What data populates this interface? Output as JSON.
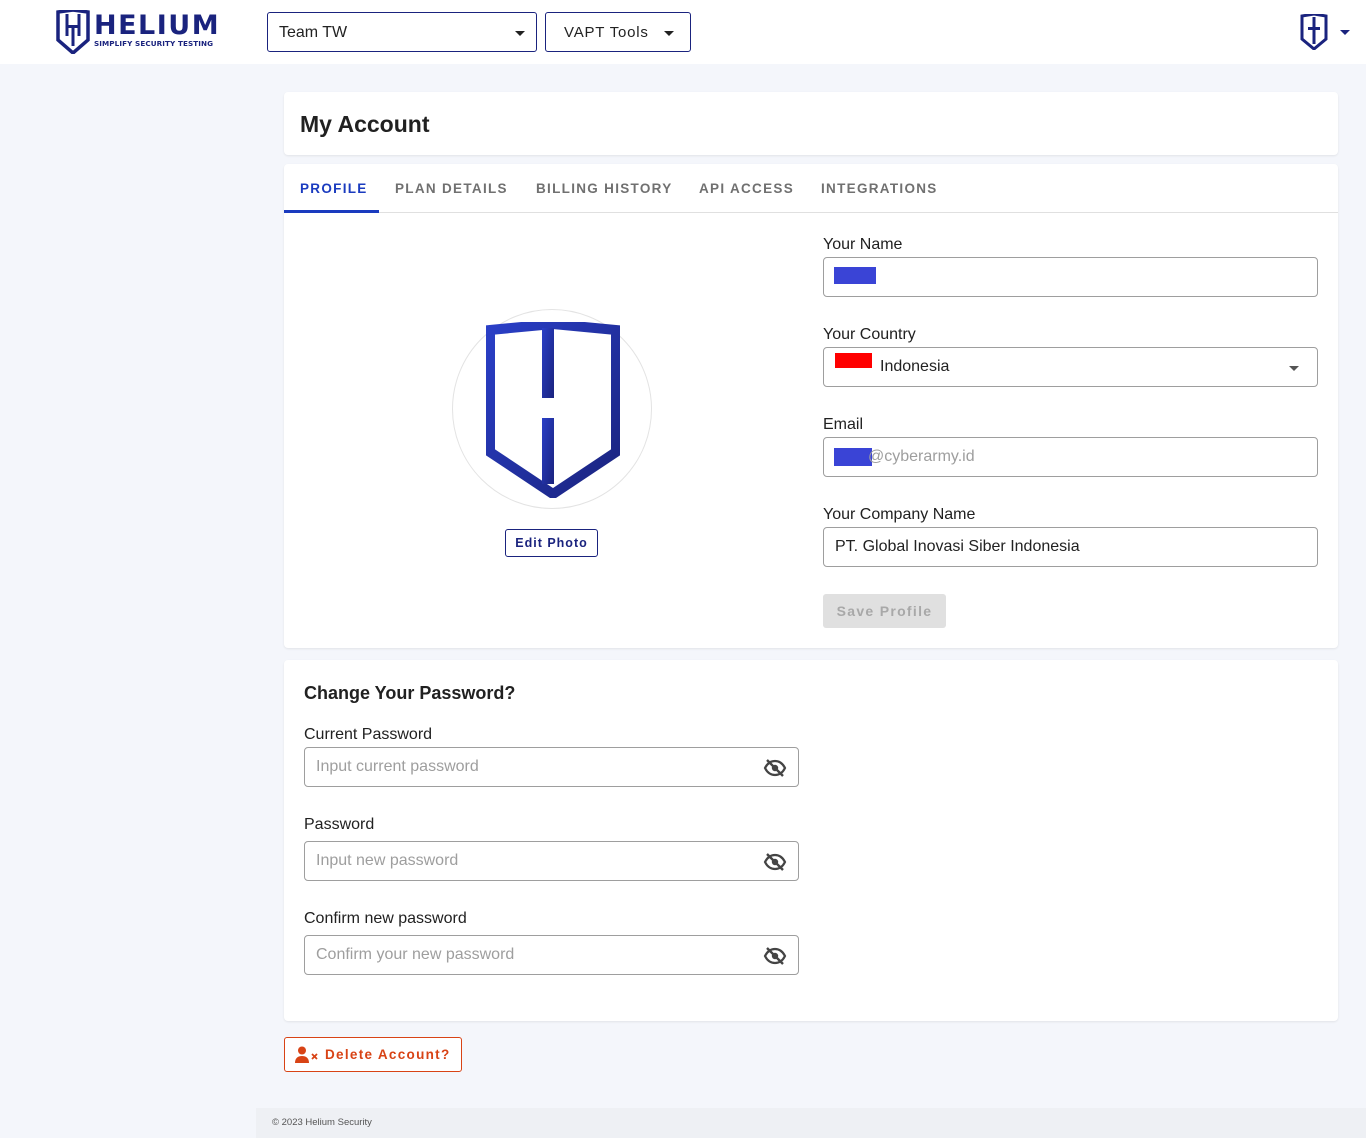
{
  "header": {
    "logo": {
      "word": "HELIUM",
      "tagline": "SIMPLIFY SECURITY TESTING"
    },
    "team_select": {
      "value": "Team TW"
    },
    "tools_menu": {
      "label": "VAPT Tools"
    }
  },
  "page": {
    "title": "My Account"
  },
  "tabs": [
    {
      "label": "PROFILE",
      "active": true
    },
    {
      "label": "PLAN DETAILS",
      "active": false
    },
    {
      "label": "BILLING HISTORY",
      "active": false
    },
    {
      "label": "API ACCESS",
      "active": false
    },
    {
      "label": "INTEGRATIONS",
      "active": false
    }
  ],
  "profile": {
    "edit_photo_label": "Edit Photo",
    "name_label": "Your Name",
    "country_label": "Your Country",
    "country_value": "Indonesia",
    "email_label": "Email",
    "email_domain": "@cyberarmy.id",
    "company_label": "Your Company Name",
    "company_value": "PT. Global Inovasi Siber Indonesia",
    "save_label": "Save Profile"
  },
  "password": {
    "heading": "Change Your Password?",
    "current_label": "Current Password",
    "current_placeholder": "Input current password",
    "new_label": "Password",
    "new_placeholder": "Input new password",
    "confirm_label": "Confirm new password",
    "confirm_placeholder": "Confirm your new password"
  },
  "delete_label": "Delete Account?",
  "footer": {
    "copyright": "© 2023 Helium Security"
  },
  "colors": {
    "brand": "#1a237e",
    "accent": "#1a3bbf",
    "danger": "#d84315",
    "redaction": "#3a44d6"
  },
  "icons": [
    "helium-shield-logo-icon",
    "caret-down-icon",
    "eye-off-icon",
    "user-remove-icon"
  ]
}
